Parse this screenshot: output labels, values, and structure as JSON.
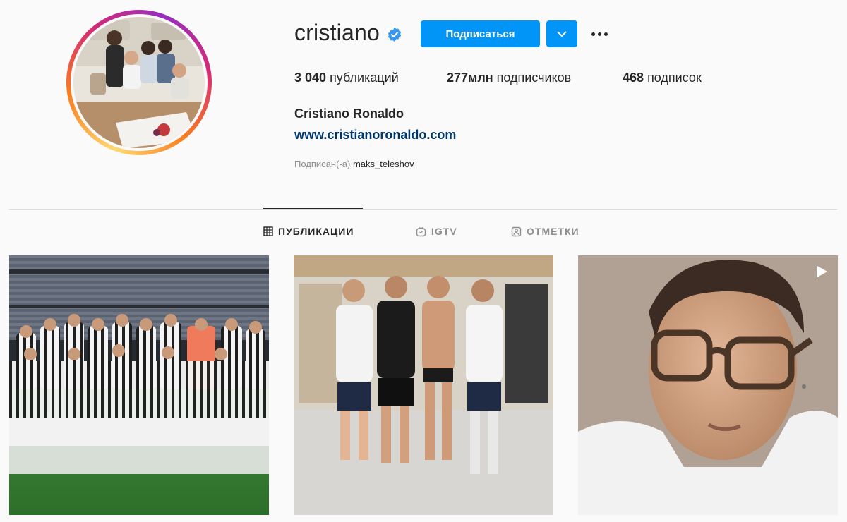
{
  "profile": {
    "username": "cristiano",
    "verified": true,
    "follow_label": "Подписаться",
    "stats": {
      "posts_value": "3 040",
      "posts_label": "публикаций",
      "followers_value": "277млн",
      "followers_label": "подписчиков",
      "following_value": "468",
      "following_label": "подписок"
    },
    "full_name": "Cristiano Ronaldo",
    "website": "www.cristianoronaldo.com",
    "followed_by_label": "Подписан(-а)",
    "followed_by_user": "maks_teleshov"
  },
  "tabs": [
    {
      "label": "ПУБЛИКАЦИИ",
      "icon": "grid-icon",
      "active": true
    },
    {
      "label": "IGTV",
      "icon": "igtv-icon",
      "active": false
    },
    {
      "label": "ОТМЕТКИ",
      "icon": "tagged-icon",
      "active": false
    }
  ],
  "posts": [
    {
      "type": "image",
      "icon": null
    },
    {
      "type": "image",
      "icon": null
    },
    {
      "type": "video",
      "icon": "video-icon"
    }
  ],
  "colors": {
    "background": "#fafafa",
    "accent": "#0095f6",
    "link": "#00376b",
    "text": "#262626",
    "muted": "#8e8e8e",
    "divider": "#dbdbdb"
  }
}
